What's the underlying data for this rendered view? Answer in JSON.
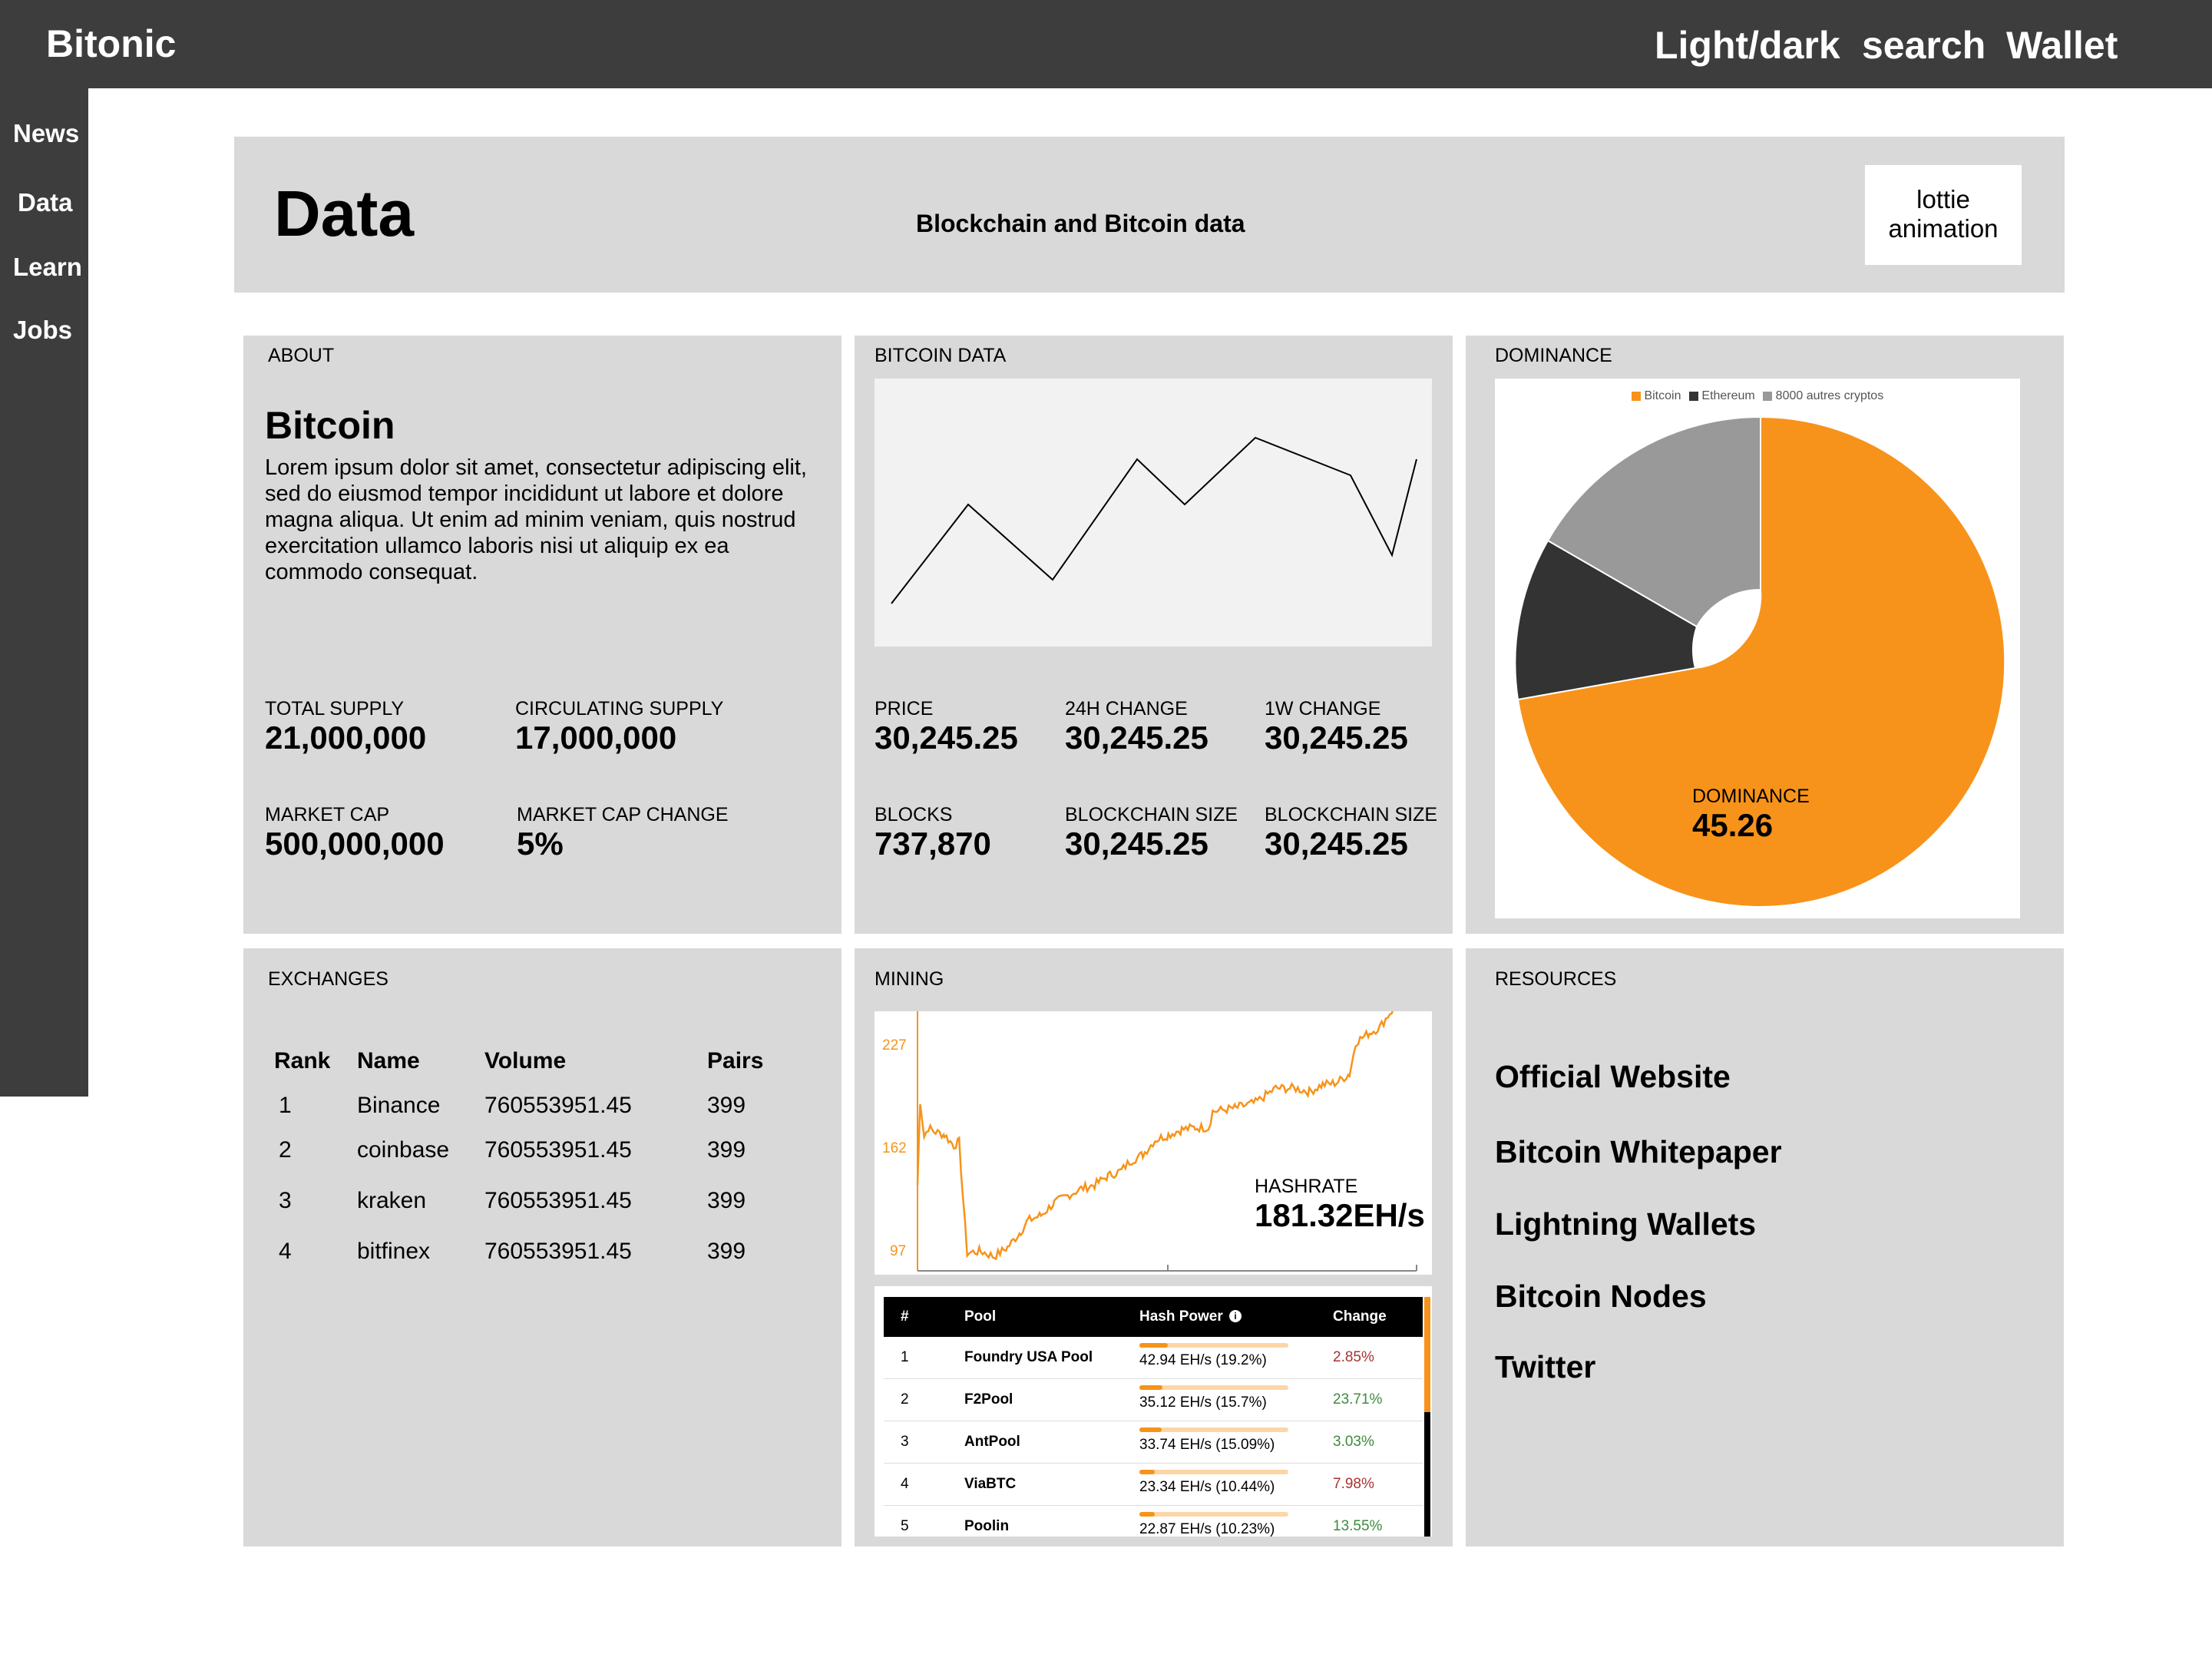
{
  "app": {
    "brand": "Bitonic",
    "top_nav": [
      "Light/dark",
      "search",
      "Wallet"
    ]
  },
  "sidebar": {
    "items": [
      "News",
      "Data",
      "Learn",
      "Jobs"
    ]
  },
  "header": {
    "title": "Data",
    "subtitle": "Blockchain and Bitcoin data",
    "animation_placeholder": "lottie animation"
  },
  "about": {
    "label": "ABOUT",
    "title": "Bitcoin",
    "text": "Lorem ipsum dolor sit amet, consectetur adipiscing elit, sed do eiusmod tempor incididunt ut labore et dolore magna aliqua. Ut enim ad minim veniam, quis nostrud exercitation ullamco laboris nisi ut aliquip ex ea commodo consequat.",
    "stats": [
      {
        "label": "TOTAL SUPPLY",
        "value": "21,000,000"
      },
      {
        "label": "CIRCULATING SUPPLY",
        "value": "17,000,000"
      },
      {
        "label": "MARKET CAP",
        "value": "500,000,000"
      },
      {
        "label": "MARKET CAP CHANGE",
        "value": "5%"
      }
    ]
  },
  "bitcoin_data": {
    "label": "BITCOIN DATA",
    "stats": [
      {
        "label": "PRICE",
        "value": "30,245.25"
      },
      {
        "label": "24H CHANGE",
        "value": "30,245.25"
      },
      {
        "label": "1W CHANGE",
        "value": "30,245.25"
      },
      {
        "label": "BLOCKS",
        "value": "737,870"
      },
      {
        "label": "BLOCKCHAIN SIZE",
        "value": "30,245.25"
      },
      {
        "label": "BLOCKCHAIN SIZE",
        "value": "30,245.25"
      }
    ],
    "sparkline": [
      0.16,
      0.53,
      0.25,
      0.7,
      0.53,
      0.78,
      0.64,
      0.34,
      0.7
    ]
  },
  "dominance": {
    "label": "DOMINANCE",
    "legend": [
      "Bitcoin",
      "Ethereum",
      "8000 autres cryptos"
    ],
    "inner_label": "DOMINANCE",
    "inner_value": "45.26",
    "colors": {
      "bitcoin": "#f7931a",
      "ethereum": "#333333",
      "others": "#999999"
    }
  },
  "exchanges": {
    "label": "EXCHANGES",
    "columns": [
      "Rank",
      "Name",
      "Volume",
      "Pairs"
    ],
    "rows": [
      [
        "1",
        "Binance",
        "760553951.45",
        "399"
      ],
      [
        "2",
        "coinbase",
        "760553951.45",
        "399"
      ],
      [
        "3",
        "kraken",
        "760553951.45",
        "399"
      ],
      [
        "4",
        "bitfinex",
        "760553951.45",
        "399"
      ]
    ]
  },
  "mining": {
    "label": "MINING",
    "hashrate_label": "HASHRATE",
    "hashrate_value": "181.32EH/s",
    "yticks": [
      "227",
      "162",
      "97"
    ],
    "pool_columns": [
      "#",
      "Pool",
      "Hash Power",
      "Change"
    ],
    "pools": [
      {
        "rank": "1",
        "name": "Foundry USA Pool",
        "power": "42.94 EH/s (19.2%)",
        "share": 0.192,
        "change": "2.85%",
        "dir": "down"
      },
      {
        "rank": "2",
        "name": "F2Pool",
        "power": "35.12 EH/s (15.7%)",
        "share": 0.157,
        "change": "23.71%",
        "dir": "up"
      },
      {
        "rank": "3",
        "name": "AntPool",
        "power": "33.74 EH/s (15.09%)",
        "share": 0.1509,
        "change": "3.03%",
        "dir": "up"
      },
      {
        "rank": "4",
        "name": "ViaBTC",
        "power": "23.34 EH/s (10.44%)",
        "share": 0.1044,
        "change": "7.98%",
        "dir": "down"
      },
      {
        "rank": "5",
        "name": "Poolin",
        "power": "22.87 EH/s (10.23%)",
        "share": 0.1023,
        "change": "13.55%",
        "dir": "up"
      }
    ]
  },
  "resources": {
    "label": "RESOURCES",
    "links": [
      "Official Website",
      "Bitcoin Whitepaper",
      "Lightning Wallets",
      "Bitcoin Nodes",
      "Twitter"
    ]
  }
}
